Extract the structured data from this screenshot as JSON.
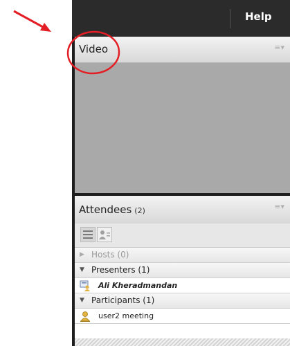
{
  "topbar": {
    "help_label": "Help"
  },
  "video_pod": {
    "title": "Video",
    "menu_icon": "pod-options-icon"
  },
  "attendees_pod": {
    "title": "Attendees",
    "count": "(2)",
    "menu_icon": "pod-options-icon",
    "toolbar": {
      "list_view_icon": "list-view-icon",
      "attendee_view_icon": "attendee-status-view-icon"
    },
    "rows": [
      {
        "label": "Hosts (0)",
        "type": "section",
        "expanded": false
      },
      {
        "label": "Presenters (1)",
        "type": "section",
        "expanded": true
      },
      {
        "label": "Ali Kheradmandan",
        "type": "user",
        "icon": "presenter-icon"
      },
      {
        "label": "Participants (1)",
        "type": "section",
        "expanded": true
      },
      {
        "label": "user2 meeting",
        "type": "user",
        "icon": "participant-icon"
      }
    ]
  },
  "colors": {
    "annotation": "#e31e24",
    "app_bg": "#1e1e1e",
    "video_area": "#a9a9a9"
  }
}
